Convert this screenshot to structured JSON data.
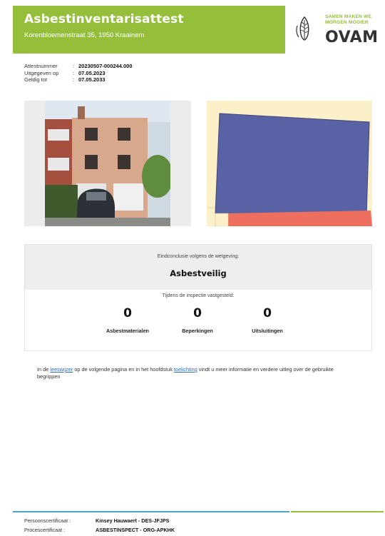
{
  "header": {
    "title": "Asbestinventarisattest",
    "address": "Korenbloemenstraat 35, 1950 Kraainem",
    "logo": {
      "slogan_line1": "SAMEN MAKEN WE",
      "slogan_line2": "MORGEN MOOIER",
      "wordmark": "OVAM",
      "icon": "leaf-logo-icon"
    }
  },
  "meta": [
    {
      "label": "Attestnummer",
      "sep": ":",
      "value": "20230507-000244.000"
    },
    {
      "label": "Uitgegeven op",
      "sep": ":",
      "value": "07.05.2023"
    },
    {
      "label": "Geldig tot",
      "sep": ":",
      "value": "07.05.2033"
    }
  ],
  "conclusion": {
    "heading": "Eindconclusie volgens de wetgeving:",
    "verdict": "Asbestveilig",
    "inspection_heading": "Tijdens de inspectie vastgesteld:",
    "stats": [
      {
        "value": "0",
        "label": "Asbestmaterialen"
      },
      {
        "value": "0",
        "label": "Beperkingen"
      },
      {
        "value": "0",
        "label": "Uitsluitingen"
      }
    ]
  },
  "note": {
    "part1": "In de ",
    "link1": "leeswijzer",
    "part2": " op de volgende pagina en in het hoofdstuk ",
    "link2": "toelichting",
    "part3": " vindt u meer informatie en verdere uitleg over de gebruikte begrippen"
  },
  "footer": {
    "rows": [
      {
        "label": "Persoonscertificaat :",
        "value": "Kinsey Hauwaert - DES-JFJPS"
      },
      {
        "label": "Procescertificaat :",
        "value": "ASBESTINSPECT - ORG-APKHK"
      }
    ]
  },
  "colors": {
    "brand_green": "#95bf3a",
    "footer_blue": "#4ea3c9",
    "map_building": "#5a62a6",
    "map_plot": "#fbf0c8",
    "map_neighbour": "#ef6f5e"
  }
}
